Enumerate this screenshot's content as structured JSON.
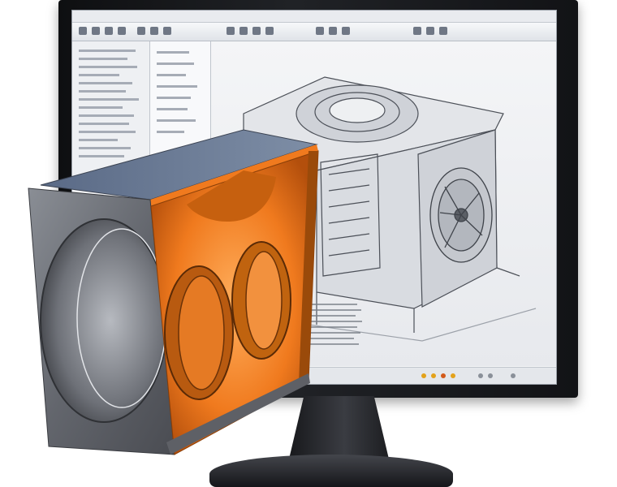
{
  "scene": {
    "subject": "cad-monitor-with-cutaway-fan-housing",
    "colors": {
      "monitor_bezel": "#16171a",
      "screen_background": "#f3f4f6",
      "accent_orange": "#f07a1e",
      "housing_gray": "#6d7077"
    },
    "icons": [
      "monitor-icon",
      "fan-icon"
    ]
  }
}
